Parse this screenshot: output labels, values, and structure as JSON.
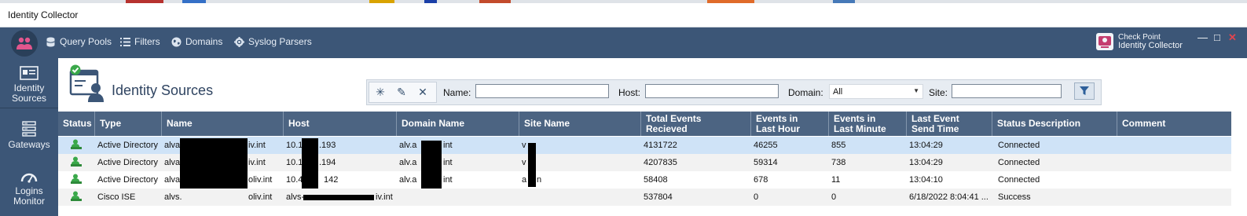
{
  "window": {
    "title": "Identity Collector"
  },
  "nav": {
    "items": [
      {
        "label": "Query Pools",
        "icon": "database-icon"
      },
      {
        "label": "Filters",
        "icon": "filter-list-icon"
      },
      {
        "label": "Domains",
        "icon": "globe-icon"
      },
      {
        "label": "Syslog Parsers",
        "icon": "syslog-parsers-icon"
      }
    ],
    "brand_line1": "Check Point",
    "brand_line2": "Identity Collector"
  },
  "sidebar": {
    "items": [
      {
        "label_line1": "Identity",
        "label_line2": "Sources",
        "icon": "identity-sources-icon",
        "active": true
      },
      {
        "label_line1": "Gateways",
        "label_line2": "",
        "icon": "gateways-icon",
        "active": false
      },
      {
        "label_line1": "Logins",
        "label_line2": "Monitor",
        "icon": "logins-monitor-icon",
        "active": false
      }
    ]
  },
  "page": {
    "title": "Identity Sources"
  },
  "toolbar": {
    "name_label": "Name:",
    "name_value": "",
    "host_label": "Host:",
    "host_value": "",
    "domain_label": "Domain:",
    "domain_value": "All",
    "site_label": "Site:",
    "site_value": ""
  },
  "table": {
    "columns": [
      "Status",
      "Type",
      "Name",
      "Host",
      "Domain Name",
      "Site Name",
      "Total Events\nRecieved",
      "Events in\nLast Hour",
      "Events in\nLast Minute",
      "Last Event\nSend Time",
      "Status Description",
      "Comment"
    ],
    "rows": [
      {
        "type": "Active Directory",
        "name": "alva",
        "name_suffix": "iv.int",
        "host": "10.1",
        "host_suffix": ".193",
        "domain": "alv.a",
        "domain_suffix": "int",
        "site": "v",
        "total": "4131722",
        "hour": "46255",
        "minute": "855",
        "last": "13:04:29",
        "status_desc": "Connected",
        "comment": ""
      },
      {
        "type": "Active Directory",
        "name": "alva",
        "name_suffix": "iv.int",
        "host": "10.1",
        "host_suffix": ".194",
        "domain": "alv.a",
        "domain_suffix": "int",
        "site": "v",
        "total": "4207835",
        "hour": "59314",
        "minute": "738",
        "last": "13:04:29",
        "status_desc": "Connected",
        "comment": ""
      },
      {
        "type": "Active Directory",
        "name": "alva",
        "name_suffix": "oliv.int",
        "host": "10.4",
        "host_suffix": "142",
        "domain": "alv.a",
        "domain_suffix": "int",
        "site": "a",
        "site_suffix": "n",
        "total": "58408",
        "hour": "678",
        "minute": "11",
        "last": "13:04:10",
        "status_desc": "Connected",
        "comment": ""
      },
      {
        "type": "Cisco ISE",
        "name": "alvs.",
        "name_suffix": "oliv.int",
        "host": "alvs-",
        "host_suffix": "iv.int",
        "domain": "",
        "domain_suffix": "",
        "site": "",
        "total": "537804",
        "hour": "0",
        "minute": "0",
        "last": "6/18/2022 8:04:41 ...",
        "status_desc": "Success",
        "comment": ""
      }
    ]
  }
}
